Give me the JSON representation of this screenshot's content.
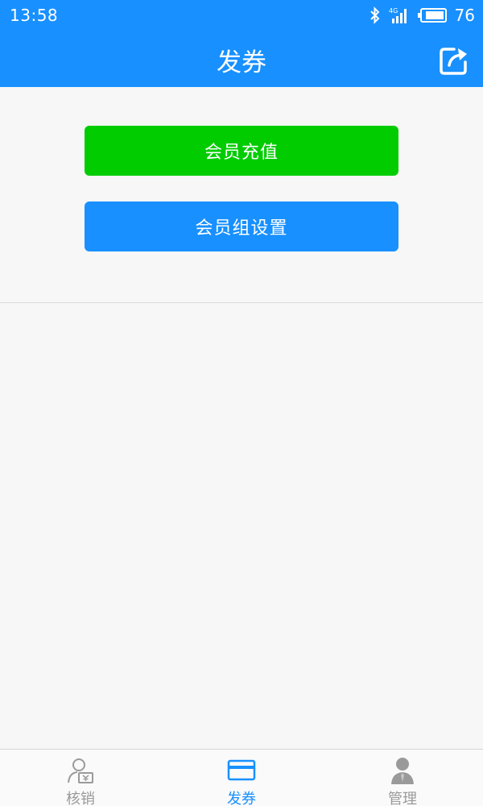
{
  "theme": {
    "primary": "#1890ff",
    "success": "#00cc00",
    "tab_active": "#1890ff",
    "tab_inactive": "#9a9a9a"
  },
  "status_bar": {
    "time": "13:58",
    "network": "4G",
    "battery": "76",
    "icons": [
      "bluetooth-icon",
      "signal-icon",
      "battery-icon"
    ]
  },
  "nav": {
    "title": "发券",
    "share_icon": "share-icon"
  },
  "actions": {
    "recharge_label": "会员充值",
    "group_settings_label": "会员组设置"
  },
  "tabs": [
    {
      "label": "核销",
      "icon": "redeem-icon",
      "active": false
    },
    {
      "label": "发券",
      "icon": "card-icon",
      "active": true
    },
    {
      "label": "管理",
      "icon": "user-icon",
      "active": false
    }
  ]
}
